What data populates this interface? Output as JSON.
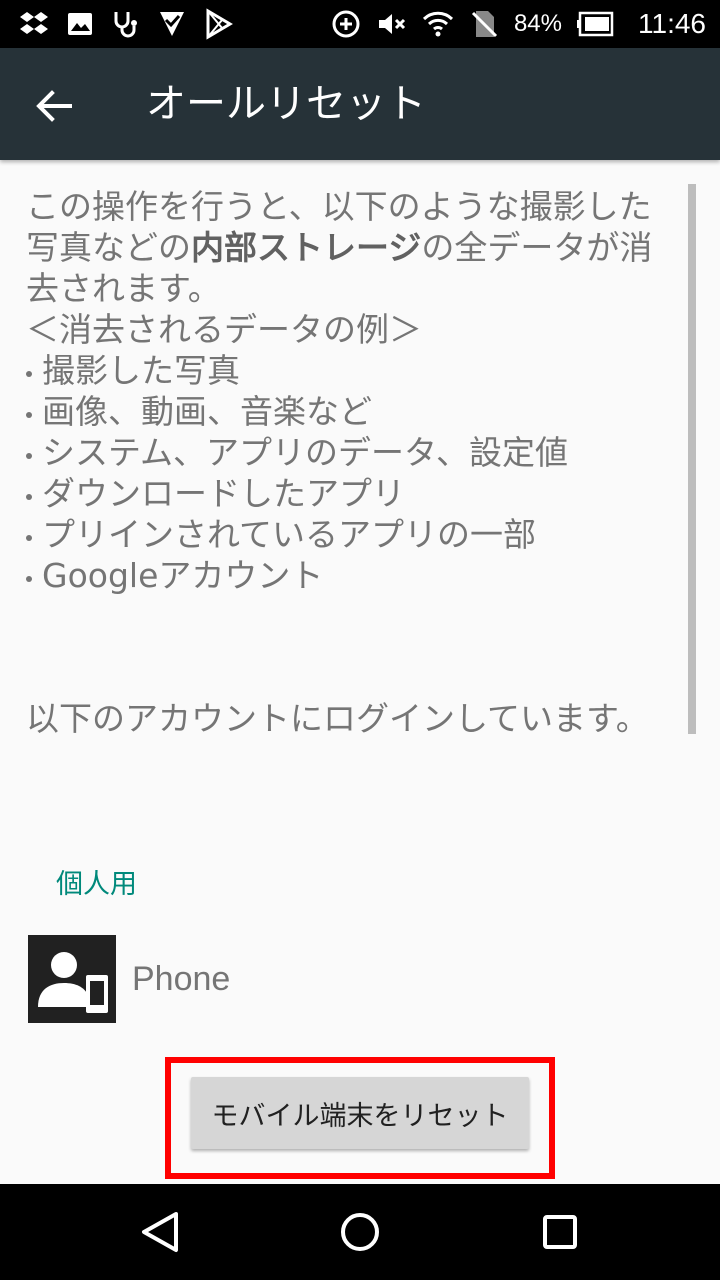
{
  "status_bar": {
    "battery_percent": "84%",
    "time": "11:46",
    "left_icons": [
      "dropbox-icon",
      "image-icon",
      "stethoscope-icon",
      "check-badge-icon",
      "play-store-icon"
    ],
    "right_icons": [
      "data-saver-icon",
      "mute-icon",
      "wifi-icon",
      "no-sim-icon",
      "battery-icon"
    ]
  },
  "app_bar": {
    "title": "オールリセット",
    "back_icon": "back-arrow-icon"
  },
  "content": {
    "intro_before": "この操作を行うと、以下のような撮影した写真などの",
    "intro_strong": "内部ストレージ",
    "intro_after": "の全データが消去されます。",
    "example_heading": "＜消去されるデータの例＞",
    "examples": [
      "撮影した写真",
      "画像、動画、音楽など",
      "システム、アプリのデータ、設定値",
      "ダウンロードしたアプリ",
      "プリインされているアプリの一部",
      "Googleアカウント"
    ],
    "login_notice": "以下のアカウントにログインしています。"
  },
  "accounts": {
    "section_label": "個人用",
    "items": [
      {
        "name": "Phone",
        "icon": "phone-account-icon"
      }
    ]
  },
  "reset_button_label": "モバイル端末をリセット",
  "colors": {
    "app_bar": "#263238",
    "accent": "#00897b",
    "highlight": "#ff0000"
  },
  "nav_bar": {
    "icons": [
      "back-triangle-icon",
      "home-circle-icon",
      "recents-square-icon"
    ]
  }
}
